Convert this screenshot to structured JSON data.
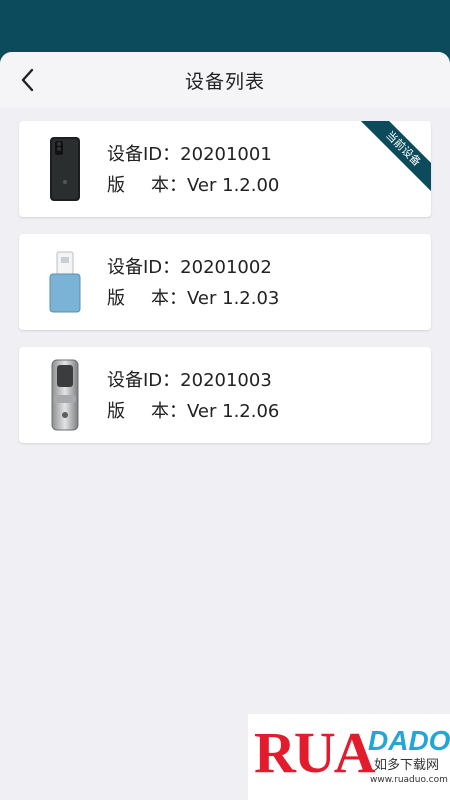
{
  "header": {
    "title": "设备列表"
  },
  "devices": [
    {
      "id_label": "设备ID：",
      "id": "20201001",
      "ver_label_1": "版",
      "ver_label_2": "本：",
      "version": "Ver 1.2.00",
      "current": true,
      "ribbon": "当前设备",
      "image": "black-phone-case"
    },
    {
      "id_label": "设备ID：",
      "id": "20201002",
      "ver_label_1": "版",
      "ver_label_2": "本：",
      "version": "Ver 1.2.03",
      "current": false,
      "image": "blue-usb-key"
    },
    {
      "id_label": "设备ID：",
      "id": "20201003",
      "ver_label_1": "版",
      "ver_label_2": "本：",
      "version": "Ver 1.2.06",
      "current": false,
      "image": "silver-door-lock"
    }
  ],
  "watermark": {
    "brand_left": "RUA",
    "brand_right": "DADO",
    "cn": "如多下载网",
    "url": "www.ruaduo.com"
  },
  "colors": {
    "header_bar": "#0b4b5c",
    "background": "#efeff4",
    "card": "#ffffff",
    "ribbon": "#0b4b5c"
  }
}
